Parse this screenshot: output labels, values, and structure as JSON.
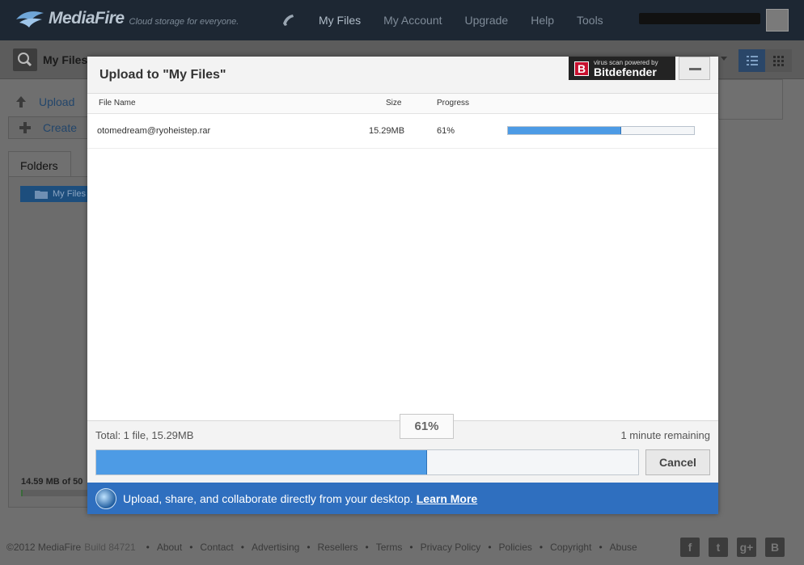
{
  "header": {
    "logo_text": "MediaFire",
    "tagline": "Cloud storage for everyone.",
    "nav": [
      "My Files",
      "My Account",
      "Upgrade",
      "Help",
      "Tools"
    ],
    "active_nav": "My Files"
  },
  "background": {
    "page_title": "My Files",
    "upload_label": "Upload",
    "create_label": "Create",
    "folders_tab": "Folders",
    "root_folder": "My Files",
    "storage_text": "14.59 MB of 50"
  },
  "modal": {
    "title": "Upload to \"My Files\"",
    "badge_small": "virus scan powered by",
    "badge_name": "Bitdefender",
    "columns": {
      "name": "File Name",
      "size": "Size",
      "progress": "Progress"
    },
    "files": [
      {
        "name": "otomedream@ryoheistep.rar",
        "size": "15.29MB",
        "progress_label": "61%",
        "progress": 0.61
      }
    ],
    "total": "Total: 1 file, 15.29MB",
    "overall_percent": "61%",
    "overall_progress": 0.61,
    "remaining": "1 minute remaining",
    "cancel_label": "Cancel",
    "promo_text": "Upload, share, and collaborate directly from your desktop.",
    "promo_link": "Learn More"
  },
  "footer": {
    "copyright": "©2012 MediaFire",
    "build": "Build 84721",
    "links": [
      "About",
      "Contact",
      "Advertising",
      "Resellers",
      "Terms",
      "Privacy Policy",
      "Policies",
      "Copyright",
      "Abuse"
    ],
    "social": [
      "f",
      "t",
      "g+",
      "B"
    ]
  },
  "colors": {
    "progress_fill": "#4d9be5",
    "promo_bg": "#2f6fbf",
    "topbar_bg": "#1d2733"
  }
}
